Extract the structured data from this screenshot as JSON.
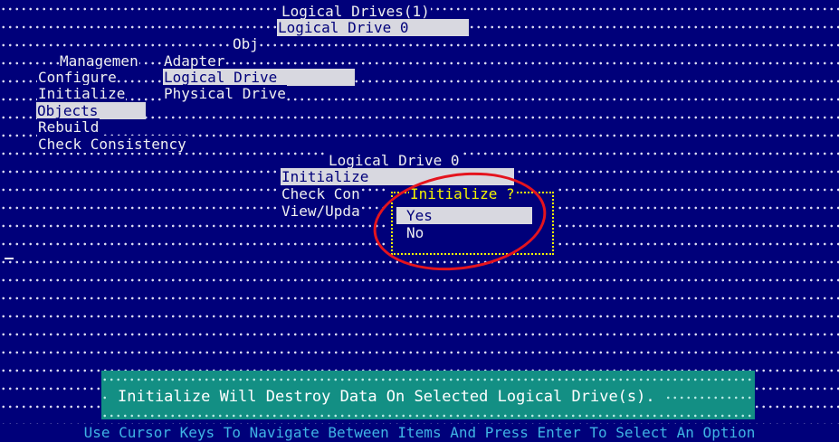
{
  "menu_logical_drives": {
    "title": "Logical Drives(1)",
    "item": "Logical Drive 0"
  },
  "menu_objects": {
    "title": "Obj"
  },
  "main_menu": {
    "management": "Managemen",
    "configure": "Configure",
    "initialize": "Initialize",
    "objects": "Objects",
    "rebuild": "Rebuild",
    "check_consistency": "Check Consistency"
  },
  "objects_menu": {
    "adapter": "Adapter",
    "logical_drive": "Logical Drive",
    "physical_drive": "Physical Drive"
  },
  "logical_drive_menu": {
    "title": "Logical Drive 0",
    "initialize": "Initialize",
    "check_consistency": "Check Con",
    "view_update": "View/Upda"
  },
  "confirm_dialog": {
    "title": "Initialize ?",
    "yes": "Yes",
    "no": "No"
  },
  "status_message": "Initialize Will Destroy Data On Selected Logical Drive(s).",
  "help_line": "Use Cursor Keys To Navigate Between Items And Press Enter To Select An Option",
  "colors": {
    "background": "#00007a",
    "highlight": "#d8d8e0",
    "dialog_title": "#f4f400",
    "status_panel": "#138f84",
    "help_text": "#3fb4e4",
    "annotation": "#e4141e"
  }
}
